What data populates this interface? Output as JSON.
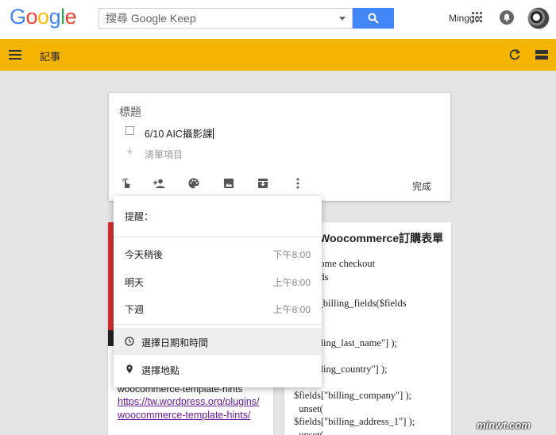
{
  "brand": {
    "letters": [
      {
        "ch": "G",
        "color": "#4285f4"
      },
      {
        "ch": "o",
        "color": "#ea4335"
      },
      {
        "ch": "o",
        "color": "#fbbc05"
      },
      {
        "ch": "g",
        "color": "#4285f4"
      },
      {
        "ch": "l",
        "color": "#34a853"
      },
      {
        "ch": "e",
        "color": "#ea4335"
      }
    ]
  },
  "search": {
    "placeholder": "搜尋 Google Keep"
  },
  "account": {
    "name": "Minggo"
  },
  "appbar": {
    "title": "記事",
    "color": "#f4b400"
  },
  "editor": {
    "title_placeholder": "標題",
    "items": [
      {
        "text": "6/10 AIC攝影課",
        "checked": false
      }
    ],
    "add_item_placeholder": "清單項目",
    "toolbar": [
      "remind-me-icon",
      "collaborator-icon",
      "palette-icon",
      "image-icon",
      "archive-icon",
      "more-icon"
    ],
    "done_label": "完成"
  },
  "reminder_menu": {
    "header": "提醒：",
    "options": [
      {
        "label": "今天稍後",
        "time": "下午8:00"
      },
      {
        "label": "明天",
        "time": "上午8:00"
      },
      {
        "label": "下週",
        "time": "上午8:00"
      }
    ],
    "pick_datetime": "選擇日期和時間",
    "pick_place": "選擇地點"
  },
  "notes": {
    "left": {
      "text": "woocommerce-template-hints",
      "link": "https://tw.wordpress.org/plugins/woocommerce-template-hints/"
    },
    "right": {
      "title": "Woocommerce訂購表單",
      "code": "nove some checkout\n  g fields\n   on\n  filter_billing_fields($fields\n\n  set(\n  s[\"billing_last_name\"] );\n  set(\n  s[\"billing_country\"] );\n  set(\n$fields[\"billing_company\"] );\n  unset(\n$fields[\"billing_address_1\"] );\n  unset("
    }
  },
  "watermark": "minwt.com"
}
